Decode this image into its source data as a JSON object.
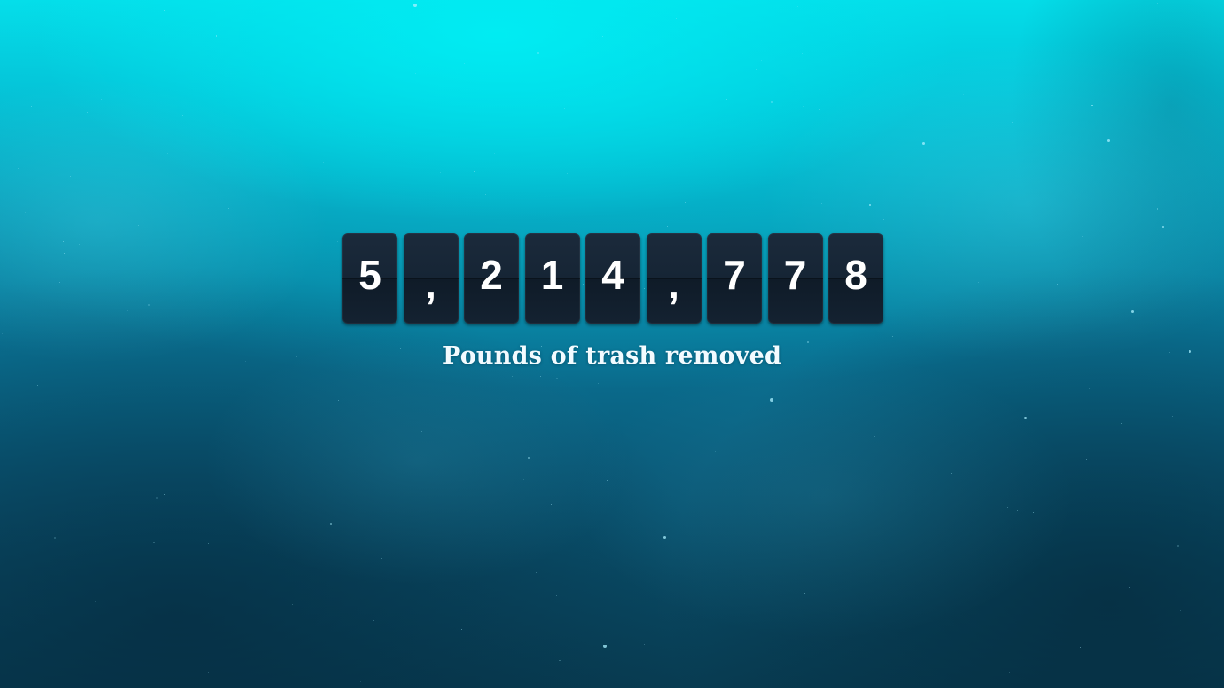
{
  "counter": {
    "value": "5,214,778",
    "digits": [
      "5",
      ",",
      "2",
      "1",
      "4",
      ",",
      "7",
      "7",
      "8"
    ]
  },
  "caption": "Pounds of trash removed",
  "colors": {
    "card_background": "#162535",
    "digit_text": "#ffffff",
    "caption_text": "#f2fbff",
    "water_top": "#05dfea",
    "water_bottom": "#083c52"
  }
}
